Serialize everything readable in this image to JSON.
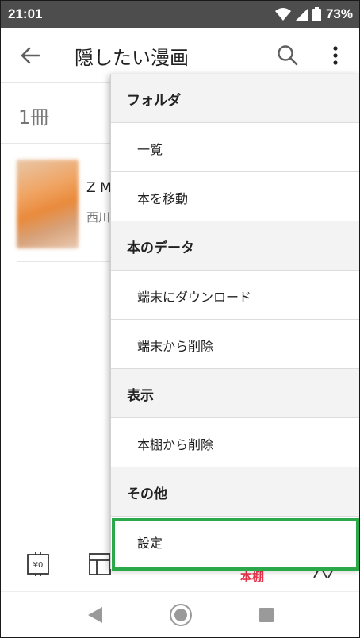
{
  "status_bar": {
    "time": "21:01",
    "battery": "73%"
  },
  "app_bar": {
    "title": "隠したい漫画",
    "icons": [
      "back-arrow-icon",
      "search-icon",
      "more-vert-icon"
    ]
  },
  "content": {
    "count": "1冊",
    "books": [
      {
        "title": "Z M",
        "author": "西川"
      }
    ]
  },
  "bottom_nav": {
    "store_icon_text": "¥0",
    "bookshelf_label": "本棚"
  },
  "menu": {
    "sections": [
      {
        "header": "フォルダ",
        "items": [
          "一覧",
          "本を移動"
        ]
      },
      {
        "header": "本のデータ",
        "items": [
          "端末にダウンロード",
          "端末から削除"
        ]
      },
      {
        "header": "表示",
        "items": [
          "本棚から削除"
        ]
      },
      {
        "header": "その他",
        "items": [
          "設定"
        ]
      }
    ]
  },
  "colors": {
    "status_bar": "#4d4d4d",
    "accent_red": "#e8334a",
    "highlight_green": "#2aa84a",
    "menu_header_bg": "#f3f3f3"
  }
}
